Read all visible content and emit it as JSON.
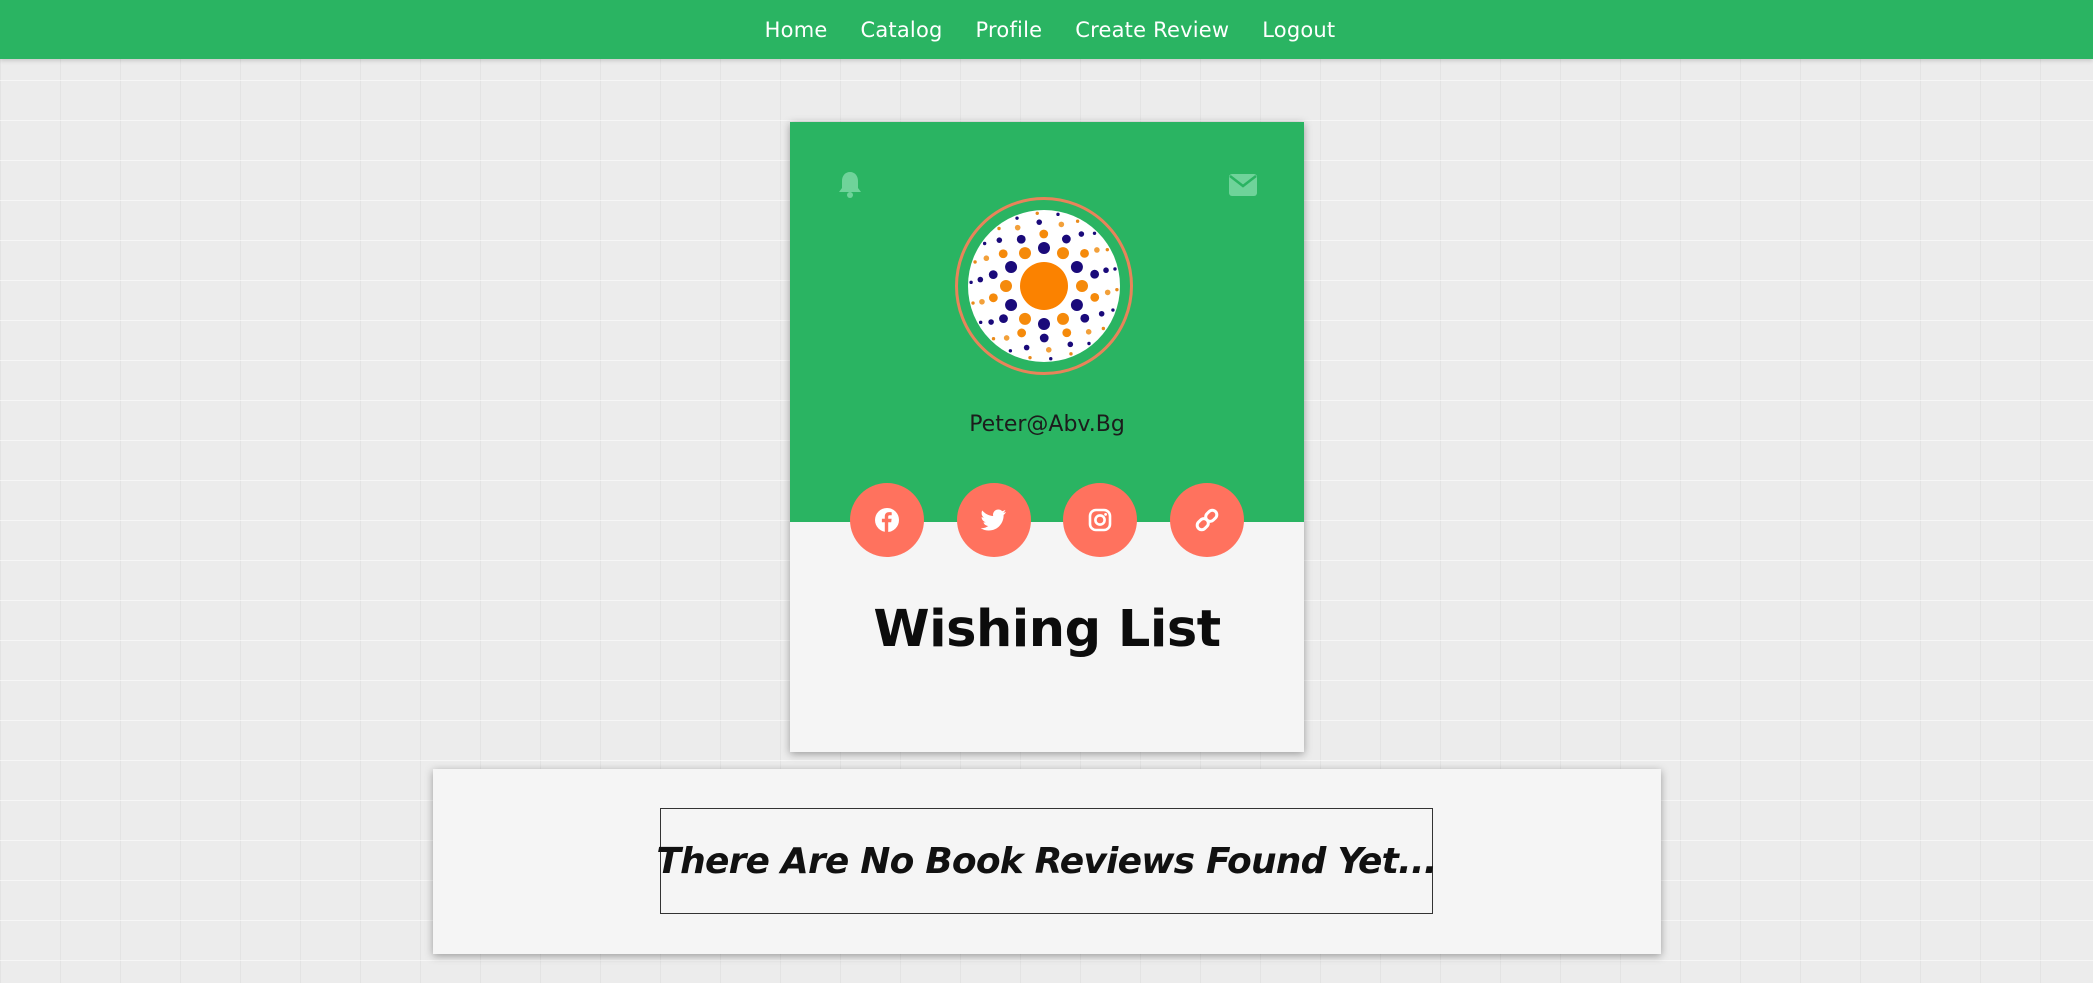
{
  "nav": {
    "items": [
      {
        "label": "Home"
      },
      {
        "label": "Catalog"
      },
      {
        "label": "Profile"
      },
      {
        "label": "Create Review"
      },
      {
        "label": "Logout"
      }
    ]
  },
  "profile": {
    "email": "Peter@Abv.Bg",
    "avatar_icon": "mandala-dots-avatar",
    "header_icons": [
      "bell-icon",
      "envelope-icon"
    ],
    "social_links": [
      {
        "icon": "facebook-icon"
      },
      {
        "icon": "twitter-icon"
      },
      {
        "icon": "instagram-icon"
      },
      {
        "icon": "link-icon"
      }
    ]
  },
  "wishlist": {
    "title": "Wishing List"
  },
  "reviews": {
    "empty_message": "There Are No Book Reviews Found Yet..."
  },
  "colors": {
    "brand_green": "#2ab462",
    "accent_coral": "#ff725e",
    "avatar_ring": "#e8845a"
  }
}
